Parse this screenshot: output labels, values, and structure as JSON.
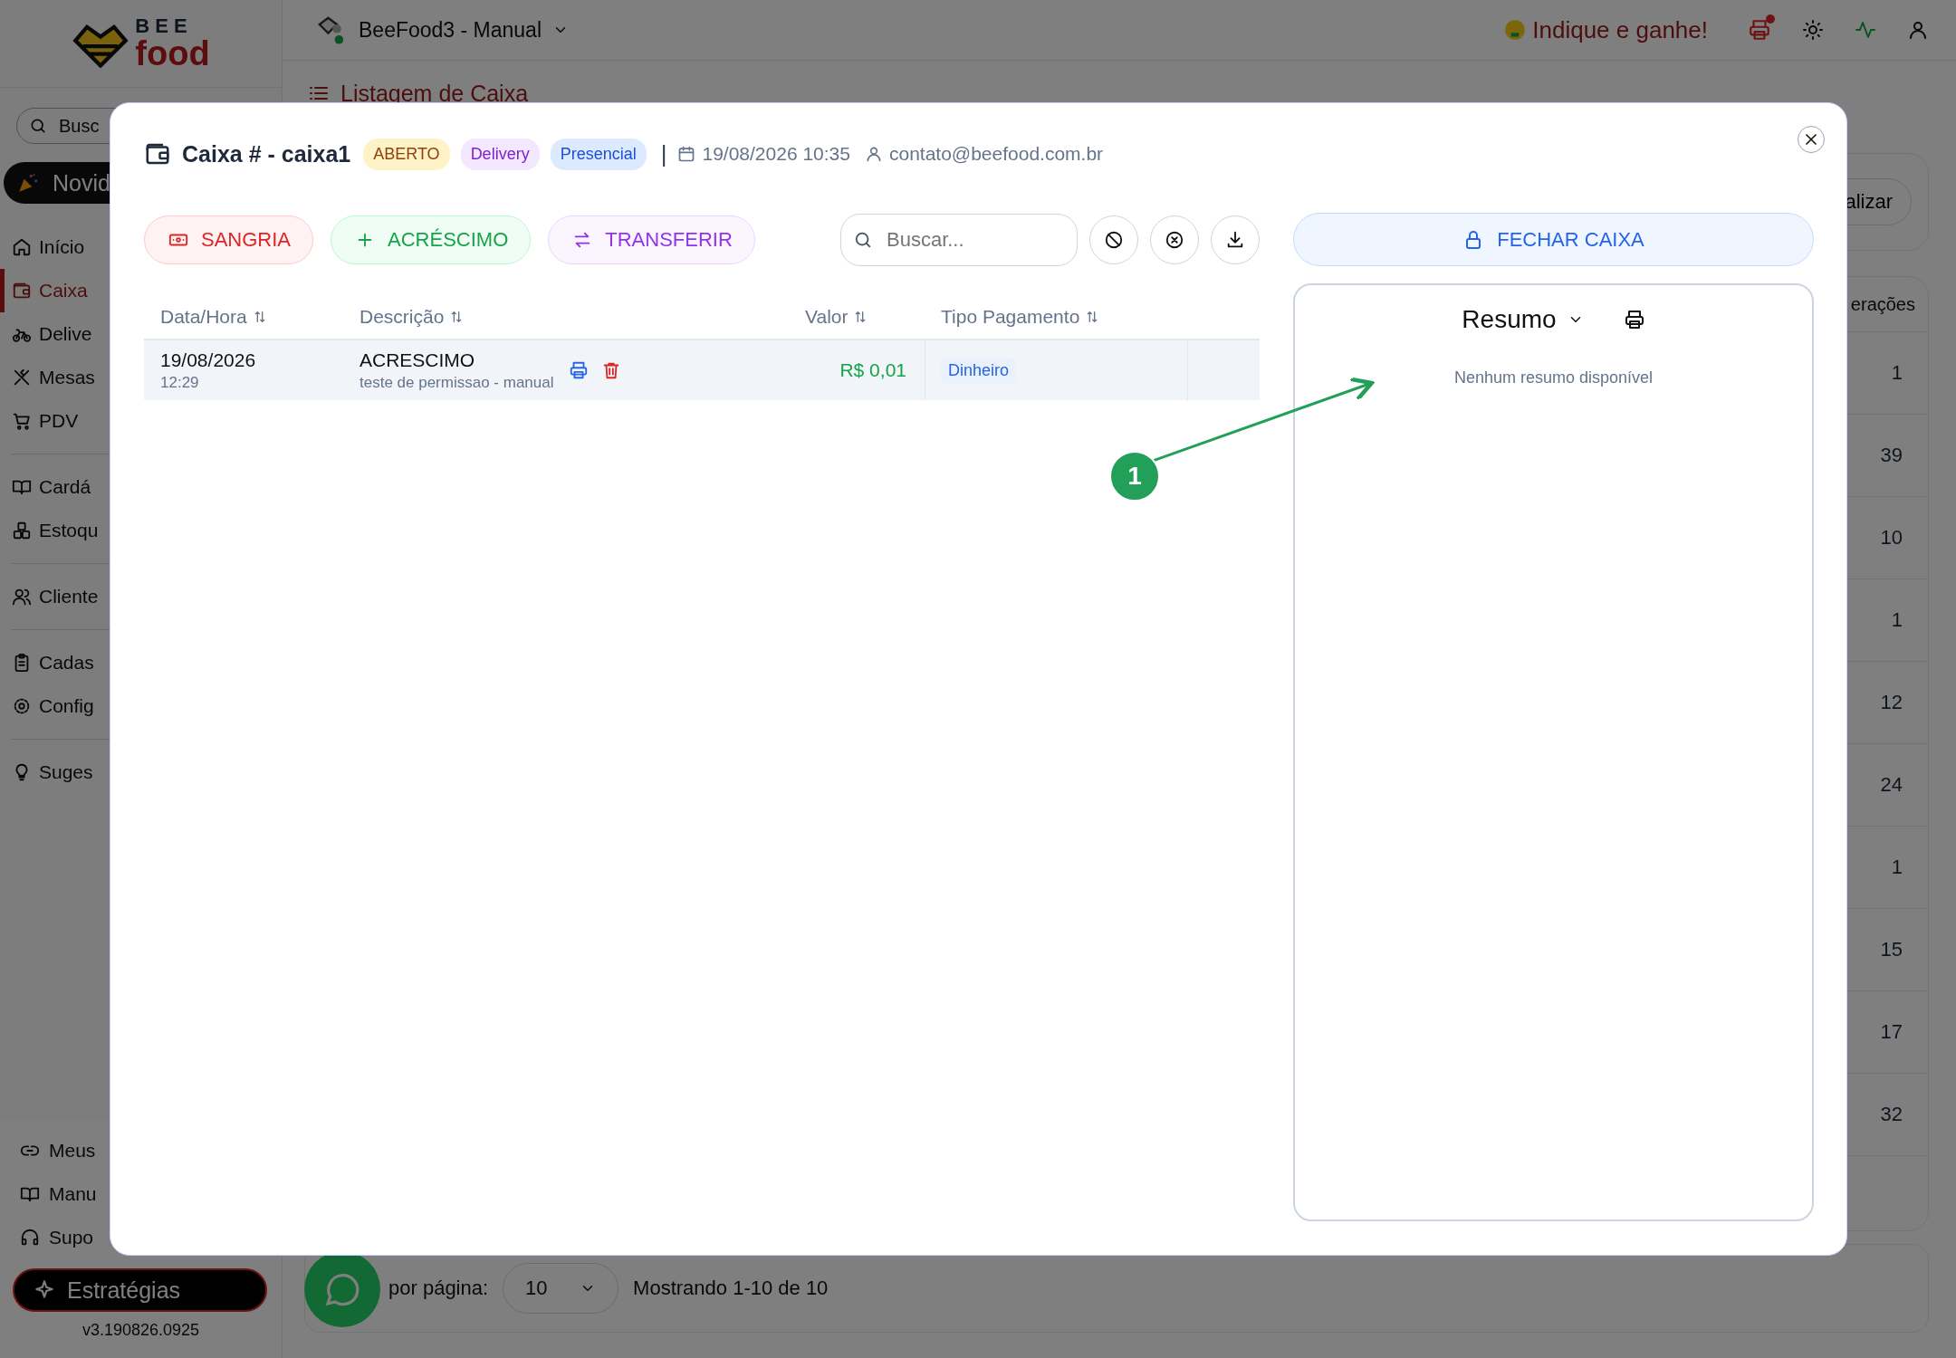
{
  "app": {
    "logo": {
      "line_1": "BEE",
      "line_2": "food"
    },
    "workspace": "BeeFood3 - Manual",
    "referral": "Indique e ganhe!",
    "printer_alert": true
  },
  "sidebar": {
    "search_placeholder": "Busc",
    "news_button": "Novid",
    "nav_sections": [
      {
        "items": [
          {
            "label": "Início",
            "selected": false
          },
          {
            "label": "Caixa",
            "selected": true
          },
          {
            "label": "Delive",
            "selected": false
          },
          {
            "label": "Mesas",
            "selected": false
          },
          {
            "label": "PDV",
            "selected": false
          }
        ]
      },
      {
        "items": [
          {
            "label": "Cardá",
            "selected": false
          },
          {
            "label": "Estoqu",
            "selected": false
          }
        ]
      },
      {
        "items": [
          {
            "label": "Cliente",
            "selected": false
          }
        ]
      },
      {
        "items": [
          {
            "label": "Cadas",
            "selected": false
          },
          {
            "label": "Config",
            "selected": false
          }
        ]
      },
      {
        "items": [
          {
            "label": "Suges",
            "selected": false
          }
        ]
      }
    ],
    "footer_links": [
      "Meus",
      "Manu",
      "Supo"
    ],
    "strategies_button": "Estratégias",
    "version": "v3.190826.0925"
  },
  "page": {
    "title": "Listagem de Caixa",
    "toolbar_button": "alizar",
    "table": {
      "column_header": "erações",
      "cells": [
        "1",
        "39",
        "10",
        "1",
        "12",
        "24",
        "1",
        "15",
        "17",
        "32"
      ]
    },
    "pagination": {
      "per_page_label": "por página:",
      "per_page": "10",
      "range": "Mostrando 1-10 de 10"
    }
  },
  "modal": {
    "title": "Caixa # - caixa1",
    "badges": [
      {
        "label": "ABERTO",
        "color": "#fef3c7"
      },
      {
        "label": "Delivery",
        "color": "#f3e8ff"
      },
      {
        "label": "Presencial",
        "color": "#dbeafe"
      }
    ],
    "separator": "|",
    "opened_at": "19/08/2026 10:35",
    "user": "contato@beefood.com.br",
    "actions": [
      {
        "label": "SANGRIA",
        "kind": "withdraw"
      },
      {
        "label": "ACRÉSCIMO",
        "kind": "add"
      },
      {
        "label": "TRANSFERIR",
        "kind": "transfer"
      }
    ],
    "search_placeholder": "Buscar...",
    "columns": [
      "Data/Hora",
      "Descrição",
      "Valor",
      "Tipo Pagamento"
    ],
    "rows": [
      {
        "date": "19/08/2026",
        "time": "12:29",
        "type": "ACRESCIMO",
        "description": "teste de permissao - manual",
        "value": "R$ 0,01",
        "kind": "credit",
        "payment": "Dinheiro"
      }
    ],
    "close_register_button": "FECHAR CAIXA",
    "summary": {
      "title": "Resumo",
      "empty": "Nenhum resumo disponível"
    },
    "annotation": {
      "label": "1"
    }
  }
}
